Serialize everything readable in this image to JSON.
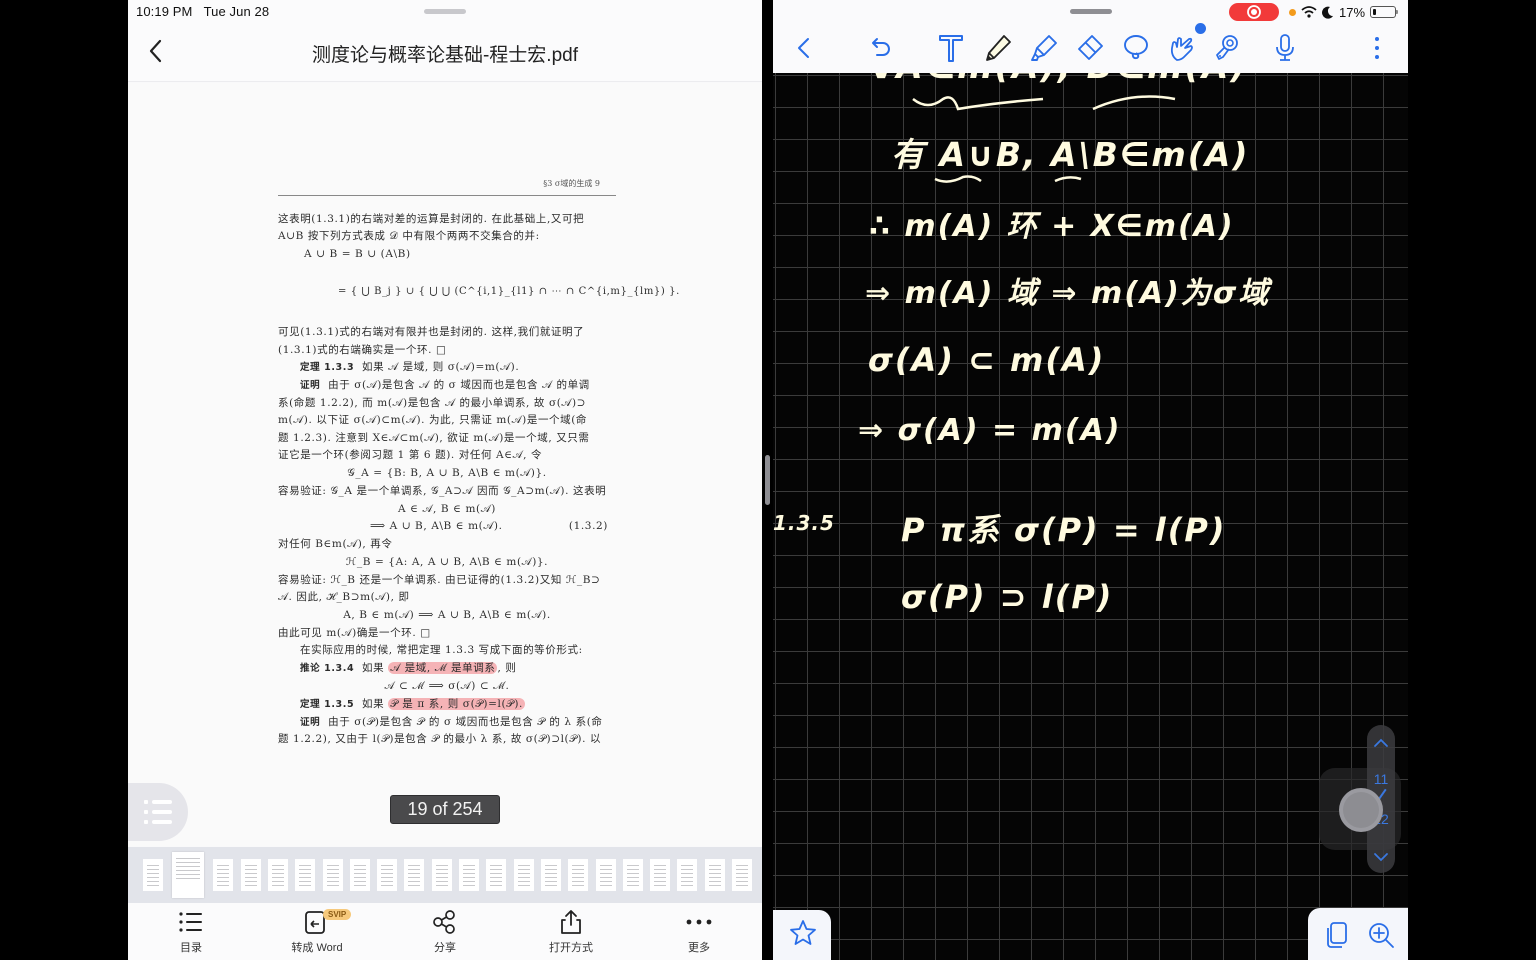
{
  "status_bar": {
    "time": "10:19 PM",
    "date": "Tue Jun 28",
    "battery": "17%"
  },
  "pdf_viewer": {
    "title": "测度论与概率论基础-程士宏.pdf",
    "page_counter": "19 of 254",
    "page": {
      "running_head": "§3  σ域的生成     9",
      "lines": [
        "这表明(1.3.1)的右端对差的运算是封闭的. 在此基础上,又可把",
        "A∪B 按下列方式表成 𝒟 中有限个两两不交集合的并:",
        "A ∪ B = B ∪ (A\\B)",
        "= { ⋃ B_j } ∪ { ⋃ ⋃ (C^{i,1}_{l1} ∩ ⋯ ∩ C^{i,m}_{lm}) }.",
        "可见(1.3.1)式的右端对有限并也是封闭的. 这样,我们就证明了",
        "(1.3.1)式的右端确实是一个环.  □",
        "如果 𝒜 是域, 则 σ(𝒜)=m(𝒜).",
        "由于 σ(𝒜)是包含 𝒜 的 σ 域因而也是包含 𝒜 的单调",
        "系(命题 1.2.2), 而 m(𝒜)是包含 𝒜 的最小单调系, 故 σ(𝒜)⊃",
        "m(𝒜). 以下证 σ(𝒜)⊂m(𝒜). 为此, 只需证 m(𝒜)是一个域(命",
        "题 1.2.3). 注意到 X∈𝒜⊂m(𝒜), 欲证 m(𝒜)是一个域, 又只需",
        "证它是一个环(参阅习题 1 第 6 题). 对任何 A∈𝒜, 令",
        "𝒢_A = {B: B, A ∪ B, A\\B ∈ m(𝒜)}.",
        "容易验证: 𝒢_A 是一个单调系, 𝒢_A⊃𝒜 因而 𝒢_A⊃m(𝒜). 这表明",
        "A ∈ 𝒜, B ∈ m(𝒜)",
        "⟹ A ∪ B, A\\B ∈ m(𝒜).",
        "对任何 B∈m(𝒜), 再令",
        "ℋ_B = {A: A, A ∪ B, A\\B ∈ m(𝒜)}.",
        "容易验证: ℋ_B 还是一个单调系. 由已证得的(1.3.2)又知 ℋ_B⊃",
        "𝒜. 因此, ℋ_B⊃m(𝒜), 即",
        "A, B ∈ m(𝒜) ⟹ A ∪ B, A\\B ∈ m(𝒜).",
        "由此可见 m(𝒜)确是一个环.  □",
        "在实际应用的时候, 常把定理 1.3.3 写成下面的等价形式:",
        "如果",
        "𝒜 是域, ℳ 是单调系",
        ", 则",
        "𝒜 ⊂ ℳ ⟹ σ(𝒜) ⊂ ℳ.",
        "如果",
        "𝒫 是 π 系, 则 σ(𝒫)=l(𝒫).",
        "由于 σ(𝒫)是包含 𝒫 的 σ 域因而也是包含 𝒫 的 λ 系(命",
        "题 1.2.2), 又由于 l(𝒫)是包含 𝒫 的最小 λ 系, 故 σ(𝒫)⊃l(𝒫). 以"
      ],
      "labels": {
        "theorem_133": "定理 1.3.3",
        "proof": "证明",
        "corollary_134": "推论 1.3.4",
        "theorem_135": "定理 1.3.5",
        "eq_132": "(1.3.2)"
      }
    },
    "highlight_color": "#f0787d",
    "bottom_bar": [
      {
        "icon": "list-icon",
        "label": "目录"
      },
      {
        "icon": "convert-word-icon",
        "label": "转成 Word",
        "badge": "SVIP"
      },
      {
        "icon": "share-icon",
        "label": "分享"
      },
      {
        "icon": "open-with-icon",
        "label": "打开方式"
      },
      {
        "icon": "more-icon",
        "label": "更多"
      }
    ]
  },
  "notes_app": {
    "toolbar": [
      {
        "icon": "back-icon"
      },
      {
        "icon": "undo-icon"
      },
      {
        "icon": "text-tool-icon"
      },
      {
        "icon": "pen-tool-icon",
        "active": true
      },
      {
        "icon": "highlighter-tool-icon"
      },
      {
        "icon": "eraser-tool-icon"
      },
      {
        "icon": "lasso-tool-icon"
      },
      {
        "icon": "hand-touch-tool-icon"
      },
      {
        "icon": "laser-pointer-tool-icon"
      },
      {
        "icon": "microphone-icon"
      },
      {
        "icon": "more-vertical-icon"
      }
    ],
    "ink_color": "#fffbe0",
    "accent_color": "#2a6ee8",
    "handwriting": [
      "∀A∈m(A), B∈m(A)",
      "有 A∪B, A\\B∈m(A)",
      "∴ m(A) 环  + X∈m(A)",
      "⇒ m(A) 域  ⇒ m(A)为σ域",
      "σ(A) ⊂ m(A)",
      "⇒ σ(A) = m(A)",
      "1.3.5",
      "P π系   σ(P) = l(P)",
      "σ(P) ⊃ l(P)"
    ],
    "page_nav": {
      "current": "11",
      "total": "12"
    }
  }
}
